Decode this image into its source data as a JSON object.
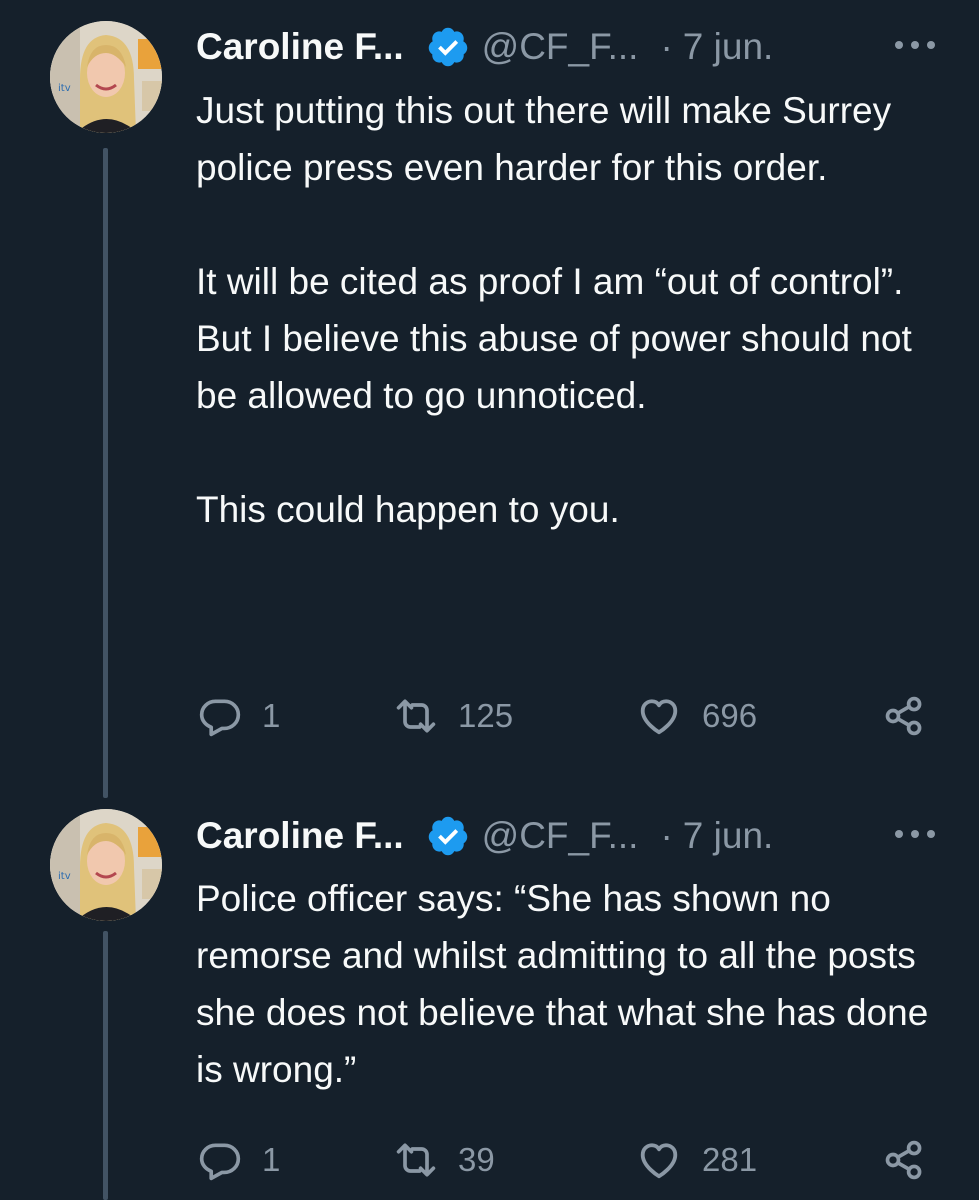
{
  "tweets": [
    {
      "author_name": "Caroline F...",
      "handle": "@CF_F...",
      "separator": "·",
      "date": "7 jun.",
      "paragraphs": [
        "Just putting this out there will make Surrey police press even harder for this order.",
        "It will be cited as proof I am “out of control”. But I believe this abuse of power should not be allowed to go unnoticed.",
        "This could happen to you."
      ],
      "replies": "1",
      "retweets": "125",
      "likes": "696"
    },
    {
      "author_name": "Caroline F...",
      "handle": "@CF_F...",
      "separator": "·",
      "date": "7 jun.",
      "paragraphs": [
        "Police officer says:  “She has shown no remorse and whilst admitting to all the posts she does not believe that what she has done is wrong.”"
      ],
      "replies": "1",
      "retweets": "39",
      "likes": "281"
    }
  ],
  "avatar_watermark": "itv",
  "icons": {
    "verified": "verified-badge-icon",
    "more": "more-dots-icon",
    "reply": "reply-bubble-icon",
    "retweet": "retweet-arrows-icon",
    "like": "heart-icon",
    "share": "share-icon"
  },
  "colors": {
    "background": "#15202b",
    "text": "#f7f9f9",
    "secondary_text": "#8b98a5",
    "verified_blue": "#1d9bf0",
    "thread_line": "#425364"
  }
}
